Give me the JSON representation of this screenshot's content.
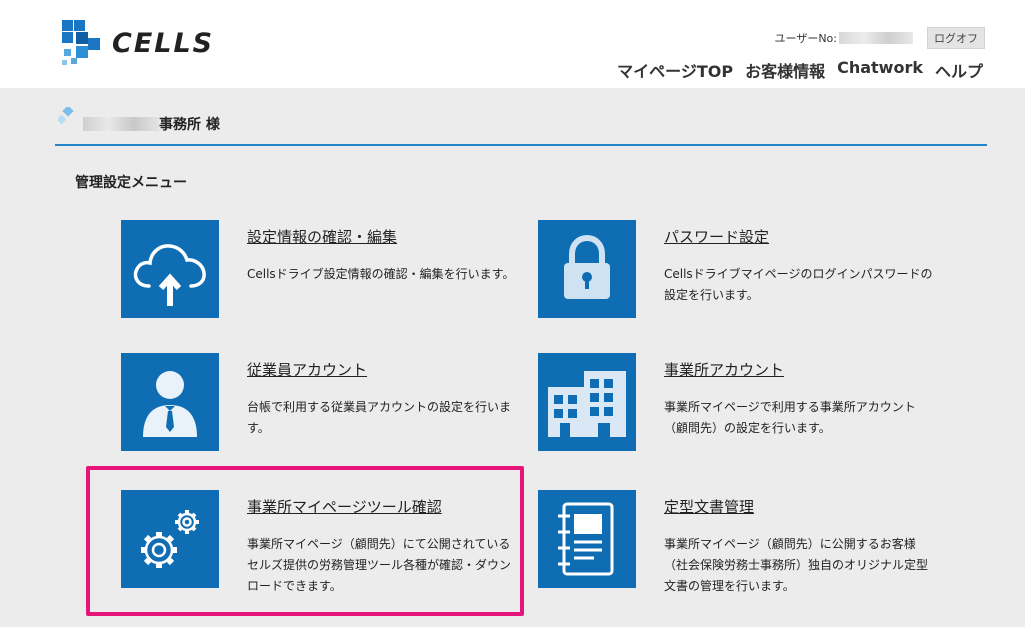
{
  "header": {
    "logo_text": "CELLS",
    "user_label": "ユーザーNo:",
    "logout_label": "ログオフ",
    "nav": [
      "マイページTOP",
      "お客様情報",
      "Chatwork",
      "ヘルプ"
    ]
  },
  "office": {
    "suffix": "事務所 様"
  },
  "menu_heading": "管理設定メニュー",
  "cards": [
    {
      "title": "設定情報の確認・編集",
      "desc": "Cellsドライブ設定情報の確認・編集を行います。",
      "icon": "cloud-upload-icon"
    },
    {
      "title": "パスワード設定",
      "desc": "Cellsドライブマイページのログインパスワードの設定を行います。",
      "icon": "lock-icon"
    },
    {
      "title": "従業員アカウント",
      "desc": "台帳で利用する従業員アカウントの設定を行います。",
      "icon": "employee-icon"
    },
    {
      "title": "事業所アカウント",
      "desc": "事業所マイページで利用する事業所アカウント（顧問先）の設定を行います。",
      "icon": "building-icon"
    },
    {
      "title": "事業所マイページツール確認",
      "desc": "事業所マイページ（顧問先）にて公開されているセルズ提供の労務管理ツール各種が確認・ダウンロードできます。",
      "icon": "gears-icon"
    },
    {
      "title": "定型文書管理",
      "desc": "事業所マイページ（顧問先）に公開するお客様（社会保険労務士事務所）独自のオリジナル定型文書の管理を行います。",
      "icon": "document-icon"
    }
  ],
  "colors": {
    "accent": "#0f6db3",
    "divider": "#2586c9",
    "highlight": "#e5157a"
  }
}
